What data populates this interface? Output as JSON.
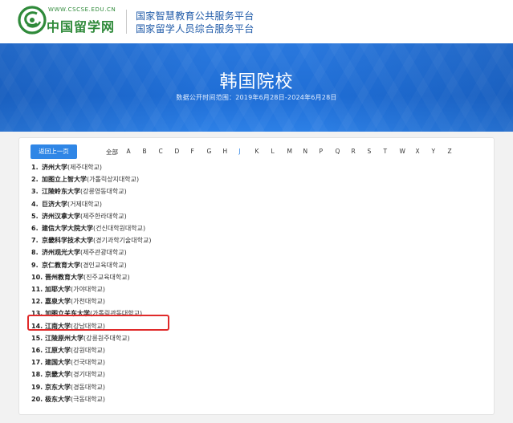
{
  "header": {
    "logo_url": "WWW.CSCSE.EDU.CN",
    "logo_name": "中国留学网",
    "platform_line1": "国家智慧教育公共服务平台",
    "platform_line2": "国家留学人员综合服务平台"
  },
  "banner": {
    "title": "韩国院校",
    "subtitle": "数据公开时间范围：2019年6月28日-2024年6月28日"
  },
  "nav": {
    "back_label": "返回上一页",
    "letters": [
      "全部",
      "A",
      "B",
      "C",
      "D",
      "F",
      "G",
      "H",
      "J",
      "K",
      "L",
      "M",
      "N",
      "P",
      "Q",
      "R",
      "S",
      "T",
      "W",
      "X",
      "Y",
      "Z"
    ],
    "active_letter": "J"
  },
  "schools": [
    {
      "num": "1.",
      "name": "济州大学",
      "kr": "(제주대학교)"
    },
    {
      "num": "2.",
      "name": "加图立上智大学",
      "kr": "(가톨릭상지대학교)"
    },
    {
      "num": "3.",
      "name": "江陵岭东大学",
      "kr": "(강릉영동대학교)"
    },
    {
      "num": "4.",
      "name": "巨济大学",
      "kr": "(거제대학교)"
    },
    {
      "num": "5.",
      "name": "济州汉拿大学",
      "kr": "(제주한라대학교)"
    },
    {
      "num": "6.",
      "name": "建信大学大院大学",
      "kr": "(건신대학원대학교)"
    },
    {
      "num": "7.",
      "name": "京畿科学技术大学",
      "kr": "(경기과학기술대학교)"
    },
    {
      "num": "8.",
      "name": "济州观光大学",
      "kr": "(제주관광대학교)"
    },
    {
      "num": "9.",
      "name": "京仁教育大学",
      "kr": "(경인교육대학교)"
    },
    {
      "num": "10.",
      "name": "晋州教育大学",
      "kr": "(진주교육대학교)"
    },
    {
      "num": "11.",
      "name": "加耶大学",
      "kr": "(가야대학교)"
    },
    {
      "num": "12.",
      "name": "嘉泉大学",
      "kr": "(가천대학교)"
    },
    {
      "num": "13.",
      "name": "加图立关东大学",
      "kr": "(가톨릭관동대학교)"
    },
    {
      "num": "14.",
      "name": "江南大学",
      "kr": "(강남대학교)"
    },
    {
      "num": "15.",
      "name": "江陵原州大学",
      "kr": "(강릉원주대학교)"
    },
    {
      "num": "16.",
      "name": "江原大学",
      "kr": "(강원대학교)"
    },
    {
      "num": "17.",
      "name": "建国大学",
      "kr": "(건국대학교)"
    },
    {
      "num": "18.",
      "name": "京畿大学",
      "kr": "(경기대학교)"
    },
    {
      "num": "19.",
      "name": "京东大学",
      "kr": "(경동대학교)"
    },
    {
      "num": "20.",
      "name": "极东大学",
      "kr": "(극동대학교)"
    }
  ],
  "colors": {
    "brand_green": "#2f8a3a",
    "platform_blue": "#1f5aa8",
    "banner_blue": "#1f6ed6",
    "button_blue": "#2f86e6",
    "highlight_red": "#e02a2a"
  },
  "highlighted_item": "14."
}
